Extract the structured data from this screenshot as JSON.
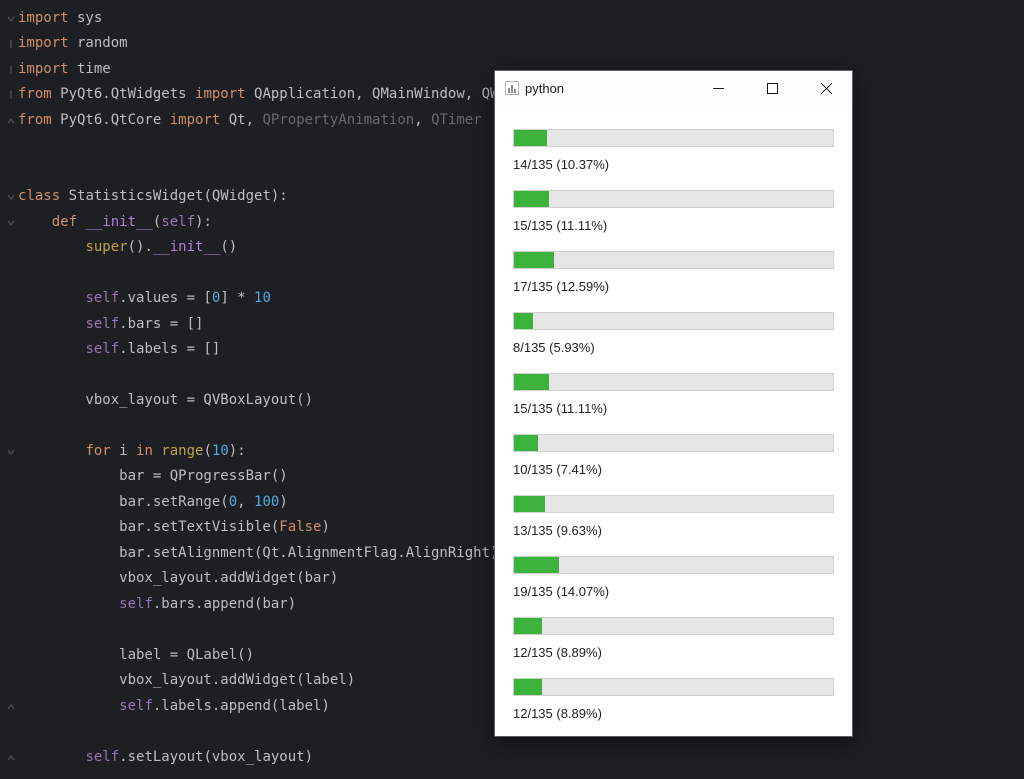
{
  "code": {
    "lines": [
      {
        "g": "down",
        "html": "<span class='kw'>import</span> sys"
      },
      {
        "g": "bar",
        "html": "<span class='kw'>import</span> random"
      },
      {
        "g": "bar",
        "html": "<span class='kw'>import</span> time"
      },
      {
        "g": "bar",
        "html": "<span class='kw'>from</span> PyQt6.QtWidgets <span class='kw'>import</span> QApplication<span class='op'>,</span> QMainWindow<span class='op'>,</span> QWidget<span class='op'>,</span> QVBoxLayout<span class='op'>,</span> QProgressBar<span class='op'>,</span> QLabel"
      },
      {
        "g": "up",
        "html": "<span class='kw'>from</span> PyQt6.QtCore <span class='kw'>import</span> Qt<span class='op'>,</span> <span class='dim'>QPropertyAnimation</span><span class='op'>,</span> <span class='dim'>QTimer</span>"
      },
      {
        "g": "",
        "html": ""
      },
      {
        "g": "",
        "html": ""
      },
      {
        "g": "down",
        "html": "<span class='kw'>class</span> <span class='ident'>StatisticsWidget</span>(QWidget):"
      },
      {
        "g": "down",
        "indent": 1,
        "html": "<span class='kw'>def</span> <span class='spec'>__init__</span>(<span class='self'>self</span>):"
      },
      {
        "g": "",
        "indent": 2,
        "html": "<span class='fn'>super</span>().<span class='spec'>__init__</span>()"
      },
      {
        "g": "",
        "indent": 2,
        "html": ""
      },
      {
        "g": "",
        "indent": 2,
        "html": "<span class='self'>self</span>.values = [<span class='num'>0</span>] * <span class='num'>10</span>"
      },
      {
        "g": "",
        "indent": 2,
        "html": "<span class='self'>self</span>.bars = []"
      },
      {
        "g": "",
        "indent": 2,
        "html": "<span class='self'>self</span>.labels = []"
      },
      {
        "g": "",
        "indent": 2,
        "html": ""
      },
      {
        "g": "",
        "indent": 2,
        "html": "vbox_layout = QVBoxLayout()"
      },
      {
        "g": "",
        "indent": 2,
        "html": ""
      },
      {
        "g": "down",
        "indent": 2,
        "html": "<span class='kw'>for</span> i <span class='kw'>in</span> <span class='fn'>range</span>(<span class='num'>10</span>):"
      },
      {
        "g": "",
        "indent": 3,
        "html": "bar = QProgressBar()"
      },
      {
        "g": "",
        "indent": 3,
        "html": "bar.setRange(<span class='num'>0</span><span class='op'>,</span> <span class='num'>100</span>)"
      },
      {
        "g": "",
        "indent": 3,
        "html": "bar.setTextVisible(<span class='kw'>False</span>)"
      },
      {
        "g": "",
        "indent": 3,
        "html": "bar.setAlignment(Qt.AlignmentFlag.AlignRight)"
      },
      {
        "g": "",
        "indent": 3,
        "html": "vbox_layout.addWidget(bar)"
      },
      {
        "g": "",
        "indent": 3,
        "html": "<span class='self'>self</span>.bars.append(bar)"
      },
      {
        "g": "",
        "indent": 3,
        "html": ""
      },
      {
        "g": "",
        "indent": 3,
        "html": "label = QLabel()"
      },
      {
        "g": "",
        "indent": 3,
        "html": "vbox_layout.addWidget(label)"
      },
      {
        "g": "up",
        "indent": 3,
        "html": "<span class='self'>self</span>.labels.append(label)"
      },
      {
        "g": "",
        "indent": 2,
        "html": ""
      },
      {
        "g": "up",
        "indent": 2,
        "html": "<span class='self'>self</span>.setLayout(vbox_layout)"
      }
    ]
  },
  "window": {
    "title": "python",
    "min_tooltip": "Minimize",
    "max_tooltip": "Maximize",
    "close_tooltip": "Close",
    "bars": [
      {
        "value": 14,
        "total": 135,
        "pct": "10.37%"
      },
      {
        "value": 15,
        "total": 135,
        "pct": "11.11%"
      },
      {
        "value": 17,
        "total": 135,
        "pct": "12.59%"
      },
      {
        "value": 8,
        "total": 135,
        "pct": "5.93%"
      },
      {
        "value": 15,
        "total": 135,
        "pct": "11.11%"
      },
      {
        "value": 10,
        "total": 135,
        "pct": "7.41%"
      },
      {
        "value": 13,
        "total": 135,
        "pct": "9.63%"
      },
      {
        "value": 19,
        "total": 135,
        "pct": "14.07%"
      },
      {
        "value": 12,
        "total": 135,
        "pct": "8.89%"
      },
      {
        "value": 12,
        "total": 135,
        "pct": "8.89%"
      }
    ]
  },
  "colors": {
    "editor_bg": "#1e1f22",
    "accent_green": "#3db33d",
    "bar_bg": "#e6e6e6"
  }
}
